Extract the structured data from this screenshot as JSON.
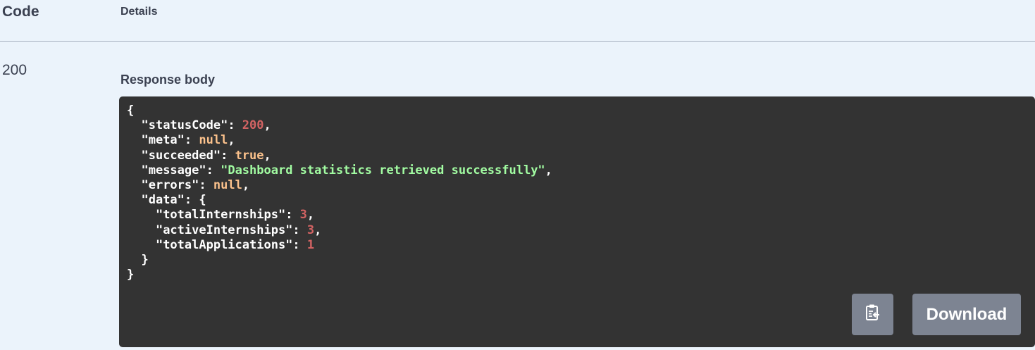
{
  "table_header": {
    "code": "Code",
    "details": "Details"
  },
  "response": {
    "status_code": "200",
    "body_label": "Response body",
    "body_lines": [
      [
        {
          "t": "punc",
          "v": "{"
        }
      ],
      [
        {
          "t": "punc",
          "v": "  "
        },
        {
          "t": "key",
          "v": "\"statusCode\""
        },
        {
          "t": "punc",
          "v": ": "
        },
        {
          "t": "num",
          "v": "200"
        },
        {
          "t": "punc",
          "v": ","
        }
      ],
      [
        {
          "t": "punc",
          "v": "  "
        },
        {
          "t": "key",
          "v": "\"meta\""
        },
        {
          "t": "punc",
          "v": ": "
        },
        {
          "t": "lit",
          "v": "null"
        },
        {
          "t": "punc",
          "v": ","
        }
      ],
      [
        {
          "t": "punc",
          "v": "  "
        },
        {
          "t": "key",
          "v": "\"succeeded\""
        },
        {
          "t": "punc",
          "v": ": "
        },
        {
          "t": "lit",
          "v": "true"
        },
        {
          "t": "punc",
          "v": ","
        }
      ],
      [
        {
          "t": "punc",
          "v": "  "
        },
        {
          "t": "key",
          "v": "\"message\""
        },
        {
          "t": "punc",
          "v": ": "
        },
        {
          "t": "str",
          "v": "\"Dashboard statistics retrieved successfully\""
        },
        {
          "t": "punc",
          "v": ","
        }
      ],
      [
        {
          "t": "punc",
          "v": "  "
        },
        {
          "t": "key",
          "v": "\"errors\""
        },
        {
          "t": "punc",
          "v": ": "
        },
        {
          "t": "lit",
          "v": "null"
        },
        {
          "t": "punc",
          "v": ","
        }
      ],
      [
        {
          "t": "punc",
          "v": "  "
        },
        {
          "t": "key",
          "v": "\"data\""
        },
        {
          "t": "punc",
          "v": ": {"
        }
      ],
      [
        {
          "t": "punc",
          "v": "    "
        },
        {
          "t": "key",
          "v": "\"totalInternships\""
        },
        {
          "t": "punc",
          "v": ": "
        },
        {
          "t": "num",
          "v": "3"
        },
        {
          "t": "punc",
          "v": ","
        }
      ],
      [
        {
          "t": "punc",
          "v": "    "
        },
        {
          "t": "key",
          "v": "\"activeInternships\""
        },
        {
          "t": "punc",
          "v": ": "
        },
        {
          "t": "num",
          "v": "3"
        },
        {
          "t": "punc",
          "v": ","
        }
      ],
      [
        {
          "t": "punc",
          "v": "    "
        },
        {
          "t": "key",
          "v": "\"totalApplications\""
        },
        {
          "t": "punc",
          "v": ": "
        },
        {
          "t": "num",
          "v": "1"
        }
      ],
      [
        {
          "t": "punc",
          "v": "  }"
        }
      ],
      [
        {
          "t": "punc",
          "v": "}"
        }
      ]
    ]
  },
  "actions": {
    "copy_icon": "clipboard-copy-icon",
    "download_label": "Download"
  },
  "colors": {
    "background": "#ebf3fb",
    "code_background": "#333333",
    "button": "#7d8492",
    "number": "#d36363",
    "literal": "#fcc28c",
    "string": "#a2fca2"
  }
}
